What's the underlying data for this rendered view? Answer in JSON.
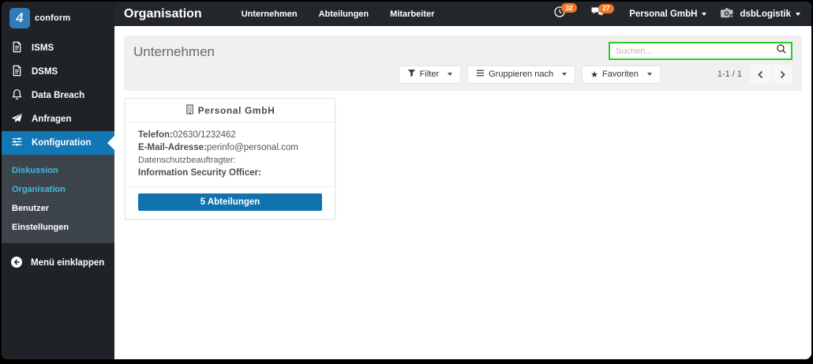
{
  "sidebar": {
    "logo_mark": "4",
    "logo_text": "conform",
    "items": [
      {
        "label": "ISMS",
        "icon": "document-icon"
      },
      {
        "label": "DSMS",
        "icon": "document-icon"
      },
      {
        "label": "Data Breach",
        "icon": "bell-icon"
      },
      {
        "label": "Anfragen",
        "icon": "send-icon"
      },
      {
        "label": "Konfiguration",
        "icon": "sliders-icon",
        "active": true
      }
    ],
    "subitems": [
      {
        "label": "Diskussion",
        "highlighted": true
      },
      {
        "label": "Organisation",
        "highlighted": true
      },
      {
        "label": "Benutzer",
        "highlighted": false
      },
      {
        "label": "Einstellungen",
        "highlighted": false
      }
    ],
    "collapse_label": "Menü einklappen"
  },
  "topbar": {
    "title": "Organisation",
    "nav": [
      {
        "label": "Unternehmen"
      },
      {
        "label": "Abteilungen"
      },
      {
        "label": "Mitarbeiter"
      }
    ],
    "history_badge": "32",
    "chat_badge": "27",
    "company_menu": "Personal GmbH",
    "user_menu": "dsbLogistik"
  },
  "content": {
    "panel_title": "Unternehmen",
    "search_placeholder": "Suchen...",
    "buttons": [
      {
        "label": "Filter"
      },
      {
        "label": "Gruppieren nach"
      },
      {
        "label": "Favoriten"
      }
    ],
    "pagination": "1-1 / 1"
  },
  "card": {
    "title": "Personal GmbH",
    "fields": [
      {
        "label": "Telefon:",
        "value": "02630/1232462"
      },
      {
        "label": "E-Mail-Adresse:",
        "value": "perinfo@personal.com"
      },
      {
        "label": "Datenschutzbeauftragter:",
        "value": ""
      },
      {
        "label": "Information Security Officer:",
        "value": ""
      }
    ],
    "button_label": "5 Abteilungen"
  },
  "colors": {
    "accent_blue": "#1173ad",
    "badge_orange": "#f07723",
    "search_green": "#2ec72e",
    "submenu_cyan": "#41b9e0",
    "logo_blue": "#2f7cb8"
  }
}
